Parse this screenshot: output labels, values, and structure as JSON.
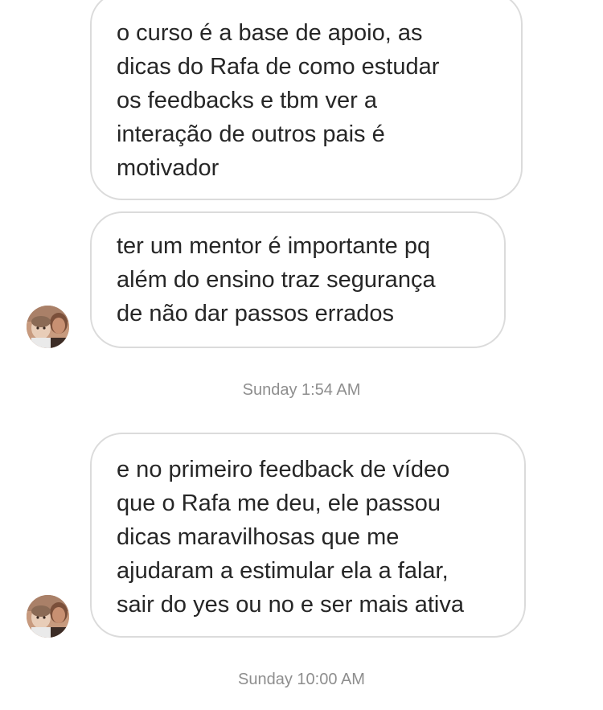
{
  "messages": [
    {
      "lines": [
        "o curso é a base de apoio, as",
        "dicas do Rafa de como estudar",
        "os feedbacks e tbm ver a",
        "interação de outros pais é",
        "motivador"
      ]
    },
    {
      "lines": [
        "ter um mentor é importante pq",
        "além do ensino traz segurança",
        "de não dar passos errados"
      ]
    },
    {
      "lines": [
        "e no primeiro feedback de vídeo",
        "que o Rafa me deu, ele passou",
        "dicas maravilhosas que me",
        "ajudaram a estimular ela a falar,",
        "sair do yes ou no e ser mais ativa"
      ]
    }
  ],
  "timestamps": [
    "Sunday 1:54 AM",
    "Sunday 10:00 AM"
  ],
  "avatars": [
    {
      "icon": "sender-avatar-photo"
    },
    {
      "icon": "sender-avatar-photo"
    }
  ]
}
